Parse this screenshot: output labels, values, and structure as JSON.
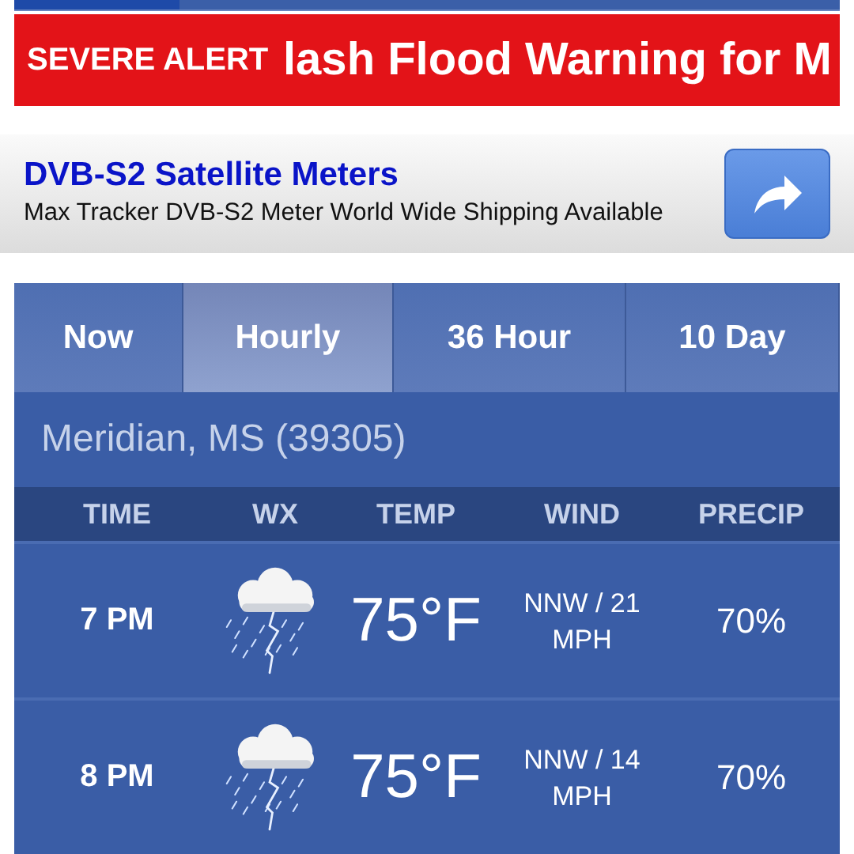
{
  "alert": {
    "label": "SEVERE ALERT",
    "message": "lash Flood Warning for M"
  },
  "ad": {
    "title": "DVB-S2 Satellite Meters",
    "description": "Max Tracker DVB-S2 Meter World Wide Shipping Available"
  },
  "tabs": [
    {
      "label": "Now",
      "selected": false
    },
    {
      "label": "Hourly",
      "selected": true
    },
    {
      "label": "36 Hour",
      "selected": false
    },
    {
      "label": "10 Day",
      "selected": false
    }
  ],
  "location": "Meridian, MS (39305)",
  "table": {
    "columns": [
      "TIME",
      "WX",
      "TEMP",
      "WIND",
      "PRECIP"
    ],
    "rows": [
      {
        "time": "7 PM",
        "temp": "75°F",
        "wind": "NNW / 21 MPH",
        "precip": "70%"
      },
      {
        "time": "8 PM",
        "temp": "75°F",
        "wind": "NNW / 14 MPH",
        "precip": "70%"
      }
    ]
  }
}
